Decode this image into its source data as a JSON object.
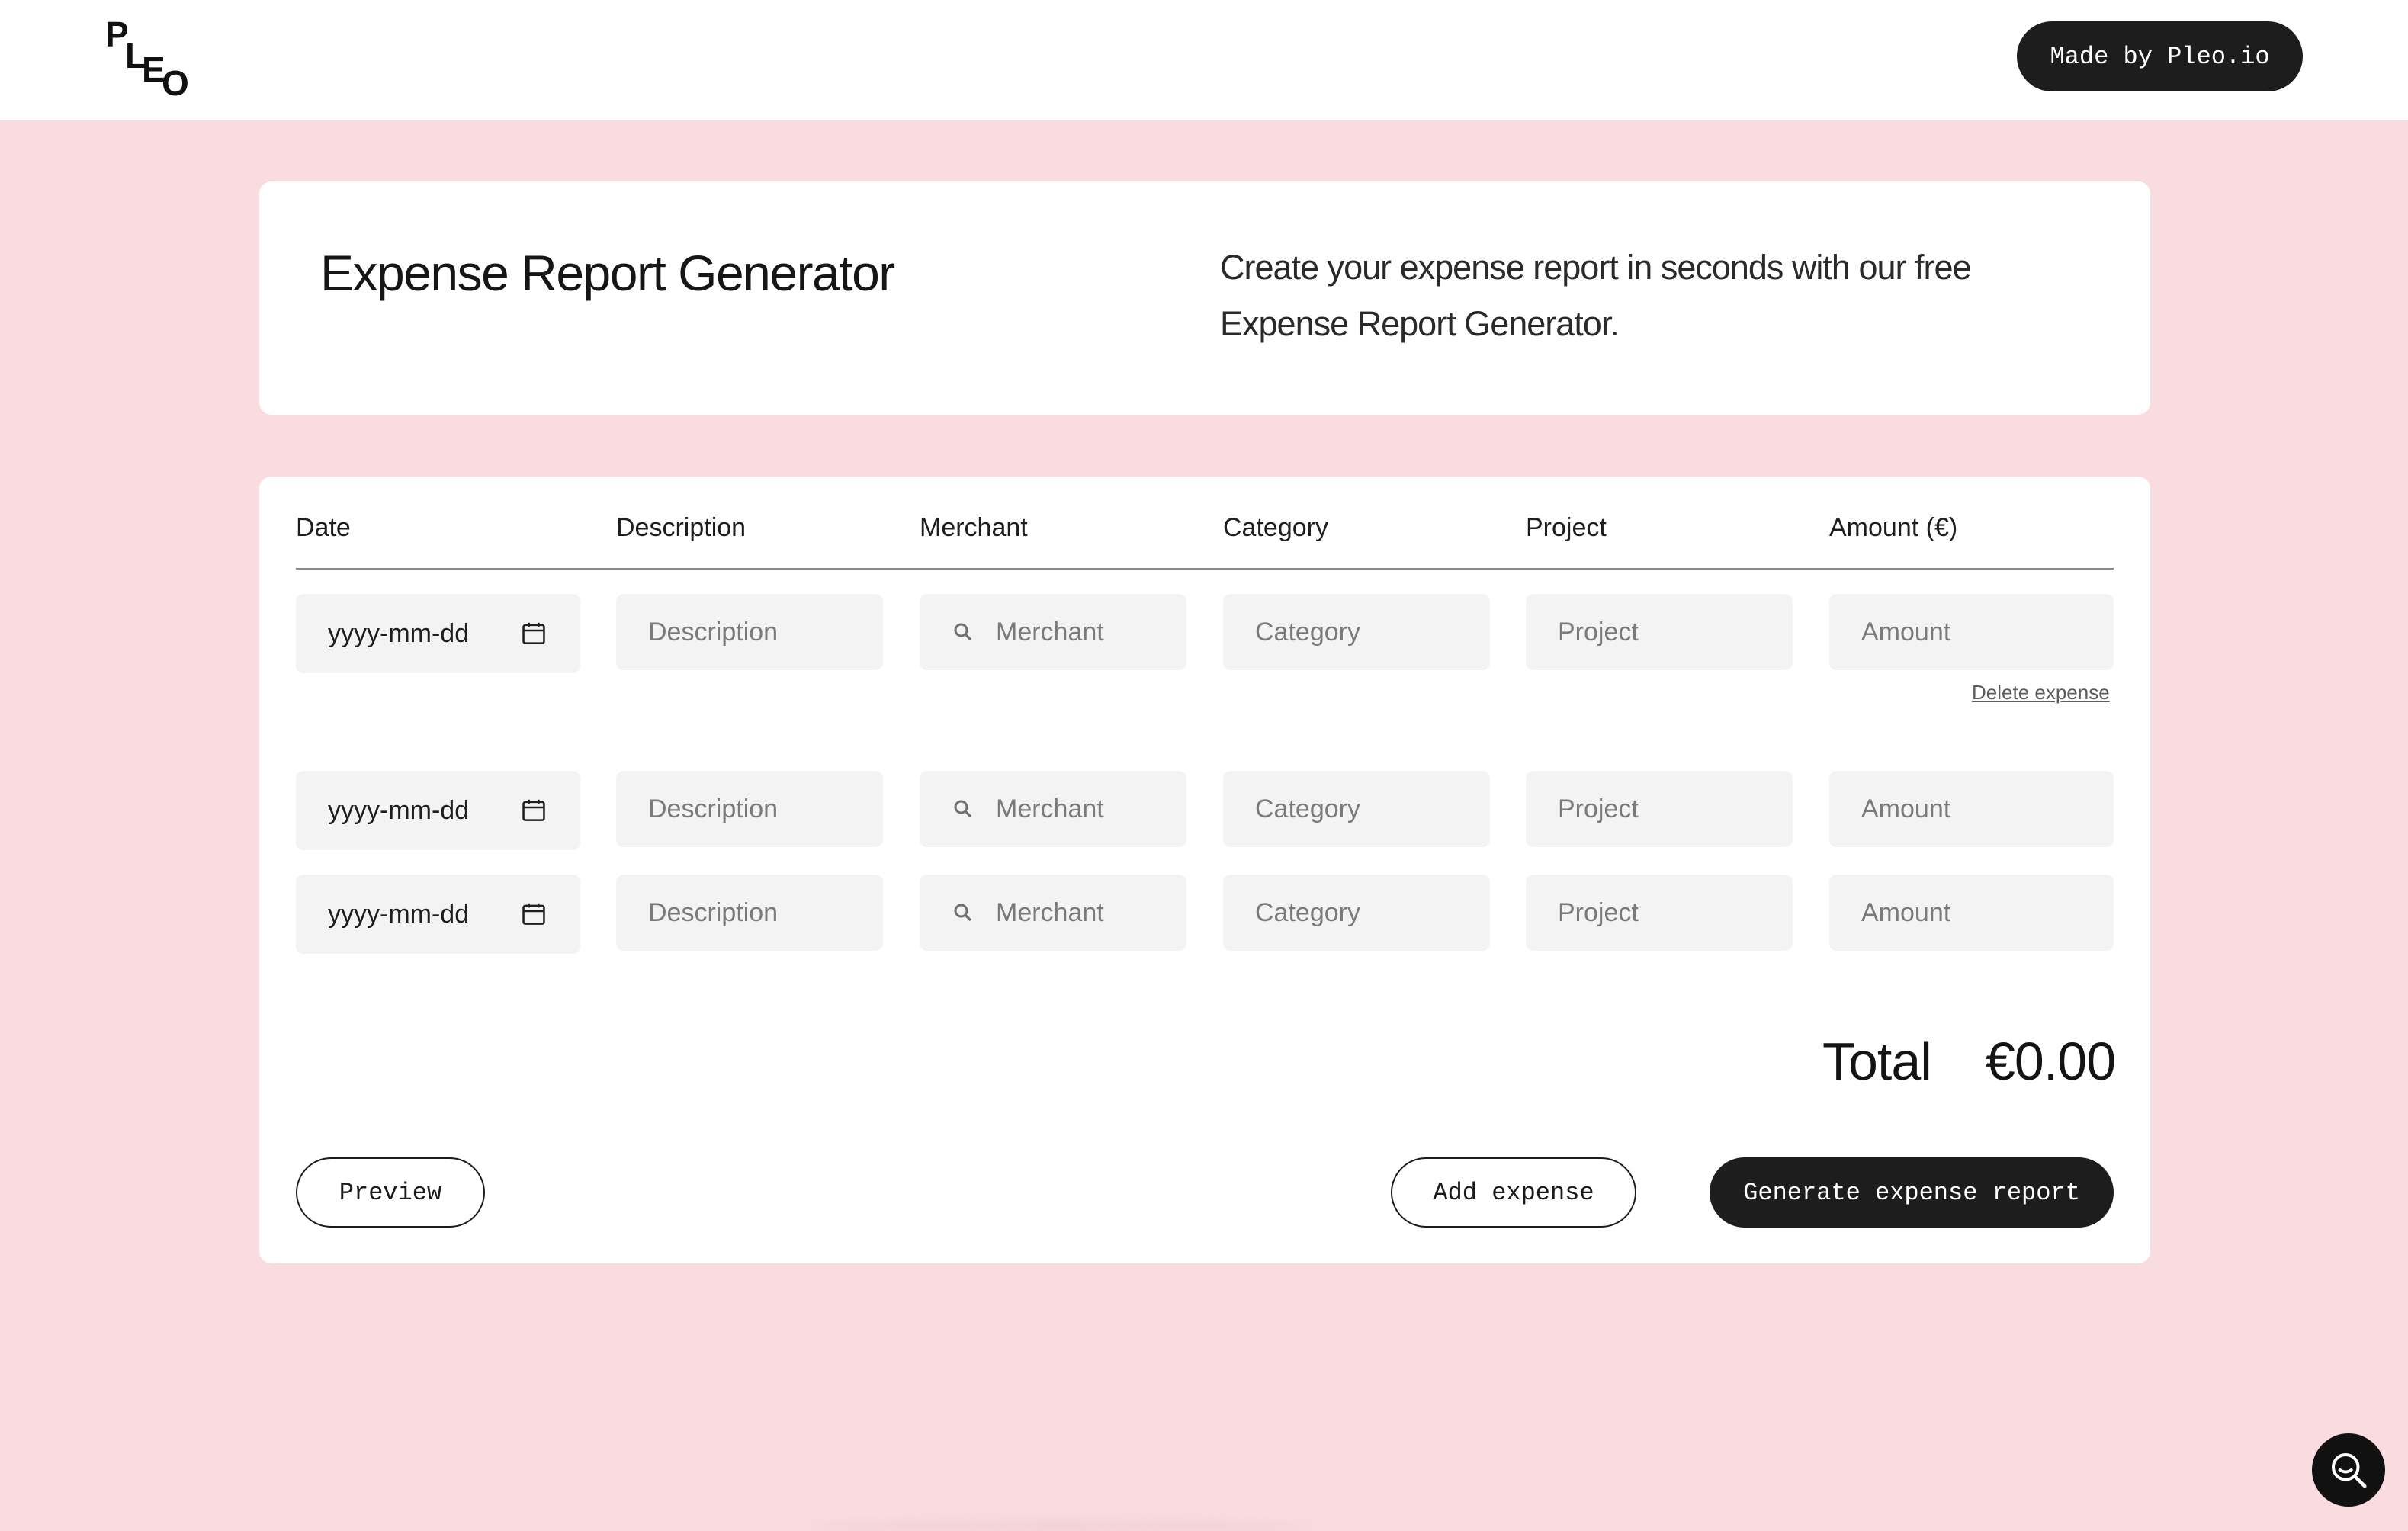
{
  "header": {
    "logo_letters": [
      "P",
      "L",
      "E",
      "O"
    ],
    "made_by_label": "Made by Pleo.io"
  },
  "hero": {
    "title": "Expense Report Generator",
    "description": "Create your expense report in seconds with our free Expense Report Generator."
  },
  "table": {
    "columns": {
      "date": "Date",
      "description": "Description",
      "merchant": "Merchant",
      "category": "Category",
      "project": "Project",
      "amount": "Amount (€)"
    },
    "placeholders": {
      "date": "yyyy-mm-dd",
      "description": "Description",
      "merchant": "Merchant",
      "category": "Category",
      "project": "Project",
      "amount": "Amount"
    },
    "rows": [
      {
        "date": "",
        "description": "",
        "merchant": "",
        "category": "",
        "project": "",
        "amount": ""
      },
      {
        "date": "",
        "description": "",
        "merchant": "",
        "category": "",
        "project": "",
        "amount": ""
      },
      {
        "date": "",
        "description": "",
        "merchant": "",
        "category": "",
        "project": "",
        "amount": ""
      }
    ],
    "delete_label": "Delete expense"
  },
  "summary": {
    "total_label": "Total",
    "total_value": "€0.00"
  },
  "actions": {
    "preview": "Preview",
    "add_expense": "Add expense",
    "generate": "Generate expense report"
  },
  "icons": {
    "date_field": "calendar-icon",
    "merchant_field": "search-icon",
    "chat_widget": "search-chat-icon"
  },
  "colors": {
    "page_background": "#f9dce0",
    "primary_dark": "#1d1d1d",
    "field_background": "#f3f3f3"
  }
}
